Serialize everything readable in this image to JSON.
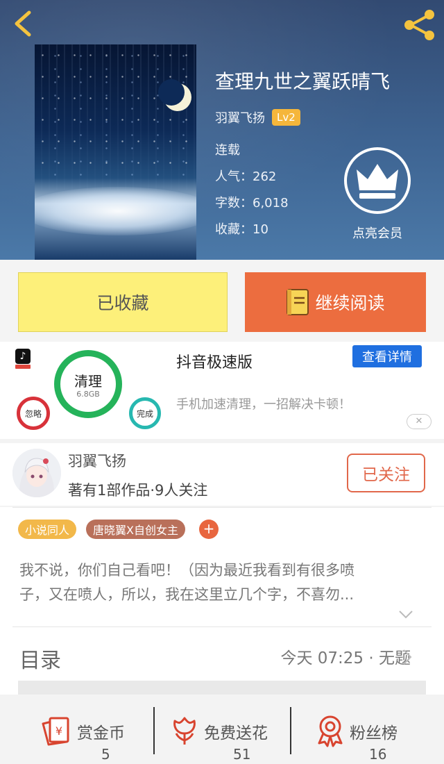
{
  "header": {
    "book_title": "查理九世之翼跃晴飞",
    "author": "羽翼飞扬",
    "level": "Lv2",
    "status": "连载",
    "popularity": "人气：262",
    "word_count": "字数：6,018",
    "favorites": "收藏：10",
    "vip_label": "点亮会员"
  },
  "actions": {
    "favorite_label": "已收藏",
    "read_label": "继续阅读"
  },
  "ad": {
    "title": "抖音极速版",
    "detail_button": "查看详情",
    "description": "手机加速清理，一招解决卡顿！",
    "image": {
      "main_label": "清理",
      "size_label": "6.8GB",
      "ignore_label": "忽略",
      "done_label": "完成"
    },
    "close_label": "✕"
  },
  "author_card": {
    "name": "羽翼飞扬",
    "stats": "著有1部作品·9人关注",
    "follow_label": "已关注"
  },
  "tags": [
    "小说同人",
    "唐晓翼X自创女主"
  ],
  "tag_add": "+",
  "description_lines": [
    "我不说，你们自己看吧！（因为最近我看到有很多喷",
    "子，又在喷人，所以，我在这里立几个字，不喜勿..."
  ],
  "catalog": {
    "title": "目录",
    "latest": "今天 07:25 · 无题"
  },
  "rewards": [
    {
      "label": "赏金币",
      "value": "5",
      "icon": "reward-coin-icon"
    },
    {
      "label": "免费送花",
      "value": "51",
      "icon": "flower-icon"
    },
    {
      "label": "粉丝榜",
      "value": "16",
      "icon": "fan-rank-icon"
    }
  ],
  "colors": {
    "accent_orange": "#ec6d3f",
    "favorite_yellow": "#fdf07a",
    "detail_blue": "#1f6fe0",
    "follow_red": "#e1674a",
    "icon_red": "#d8442f"
  }
}
